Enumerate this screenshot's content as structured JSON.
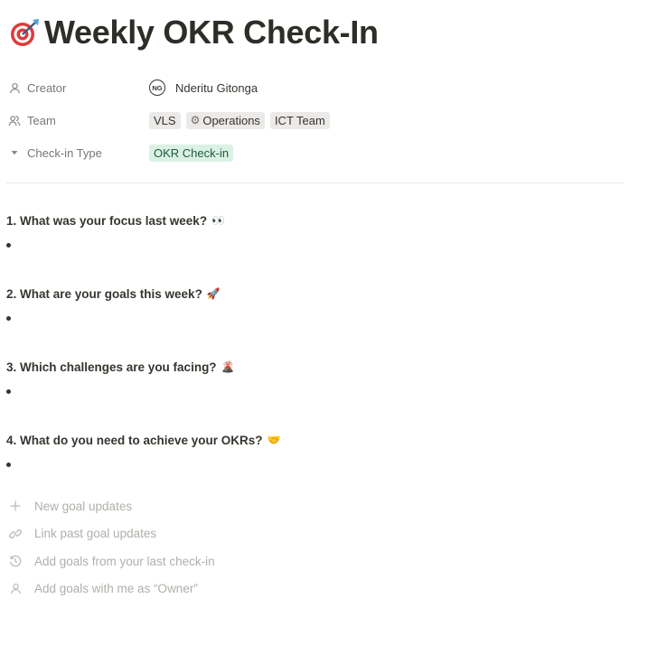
{
  "page": {
    "title": "Weekly OKR Check-In",
    "title_icon": "dart-target-icon"
  },
  "properties": {
    "creator": {
      "label": "Creator",
      "avatar_initials": "NG",
      "name": "Nderitu Gitonga"
    },
    "team": {
      "label": "Team",
      "tags": [
        "VLS",
        "Operations",
        "ICT Team"
      ]
    },
    "checkin_type": {
      "label": "Check-in Type",
      "value": "OKR Check-in"
    }
  },
  "questions": [
    {
      "text": "1. What was your focus last week?",
      "emoji": "👀"
    },
    {
      "text": "2. What are your goals this week?",
      "emoji": "🚀"
    },
    {
      "text": "3. Which challenges are you facing?",
      "emoji": "🌋"
    },
    {
      "text": "4. What do you need to achieve your OKRs?",
      "emoji": "🤝"
    }
  ],
  "actions": [
    {
      "label": "New goal updates",
      "icon": "plus-icon"
    },
    {
      "label": "Link past goal updates",
      "icon": "link-icon"
    },
    {
      "label": "Add goals from your last check-in",
      "icon": "history-icon"
    },
    {
      "label": "Add goals with me as “Owner”",
      "icon": "person-icon"
    }
  ],
  "colors": {
    "text": "#37352f",
    "muted": "#787774",
    "tag_gray": "#ebeae8",
    "tag_green": "#dbf1e5",
    "placeholder": "#b0afab"
  }
}
